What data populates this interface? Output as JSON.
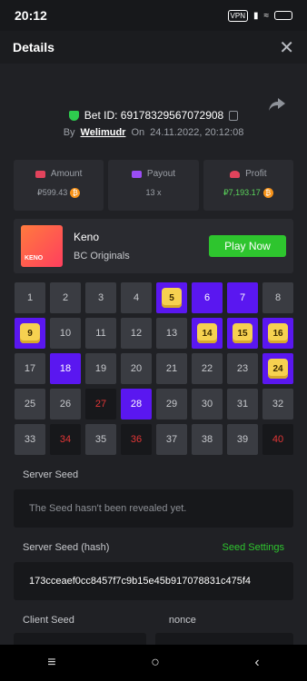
{
  "status": {
    "time": "20:12",
    "vpn": "VPN"
  },
  "header": {
    "title": "Details",
    "close": "✕"
  },
  "bet": {
    "id_label": "Bet ID: 69178329567072908",
    "by_label": "By",
    "username": "Welimudr",
    "on_label": "On",
    "date": "24.11.2022, 20:12:08"
  },
  "stats": {
    "amount": {
      "label": "Amount",
      "value": "₽599.43"
    },
    "payout": {
      "label": "Payout",
      "value": "13 x"
    },
    "profit": {
      "label": "Profit",
      "value": "₽7,193.17"
    }
  },
  "game": {
    "name": "Keno",
    "provider": "BC Originals",
    "thumb_label": "KENO",
    "play_label": "Play Now"
  },
  "keno": {
    "cells": [
      {
        "n": "1",
        "state": "normal"
      },
      {
        "n": "2",
        "state": "normal"
      },
      {
        "n": "3",
        "state": "normal"
      },
      {
        "n": "4",
        "state": "normal"
      },
      {
        "n": "5",
        "state": "hit"
      },
      {
        "n": "6",
        "state": "pick"
      },
      {
        "n": "7",
        "state": "pick"
      },
      {
        "n": "8",
        "state": "normal"
      },
      {
        "n": "9",
        "state": "hit"
      },
      {
        "n": "10",
        "state": "normal"
      },
      {
        "n": "11",
        "state": "normal"
      },
      {
        "n": "12",
        "state": "normal"
      },
      {
        "n": "13",
        "state": "normal"
      },
      {
        "n": "14",
        "state": "hit"
      },
      {
        "n": "15",
        "state": "hit"
      },
      {
        "n": "16",
        "state": "hit"
      },
      {
        "n": "17",
        "state": "normal"
      },
      {
        "n": "18",
        "state": "pick"
      },
      {
        "n": "19",
        "state": "normal"
      },
      {
        "n": "20",
        "state": "normal"
      },
      {
        "n": "21",
        "state": "normal"
      },
      {
        "n": "22",
        "state": "normal"
      },
      {
        "n": "23",
        "state": "normal"
      },
      {
        "n": "24",
        "state": "hit"
      },
      {
        "n": "25",
        "state": "normal"
      },
      {
        "n": "26",
        "state": "normal"
      },
      {
        "n": "27",
        "state": "miss"
      },
      {
        "n": "28",
        "state": "pick"
      },
      {
        "n": "29",
        "state": "normal"
      },
      {
        "n": "30",
        "state": "normal"
      },
      {
        "n": "31",
        "state": "normal"
      },
      {
        "n": "32",
        "state": "normal"
      },
      {
        "n": "33",
        "state": "normal"
      },
      {
        "n": "34",
        "state": "miss"
      },
      {
        "n": "35",
        "state": "normal"
      },
      {
        "n": "36",
        "state": "miss"
      },
      {
        "n": "37",
        "state": "normal"
      },
      {
        "n": "38",
        "state": "normal"
      },
      {
        "n": "39",
        "state": "normal"
      },
      {
        "n": "40",
        "state": "miss"
      }
    ]
  },
  "seeds": {
    "server_seed_label": "Server Seed",
    "server_seed_value": "The Seed hasn't been revealed yet.",
    "hash_label": "Server Seed (hash)",
    "settings_link": "Seed Settings",
    "hash_value": "173cceaef0cc8457f7c9b15e45b917078831c475f4",
    "client_seed_label": "Client Seed",
    "nonce_label": "nonce"
  },
  "colors": {
    "accent_green": "#2ec52e",
    "purple": "#5a17f0",
    "miss_red": "#e23636",
    "gem_yellow": "#f6d150"
  },
  "nav": {
    "menu": "≡",
    "home": "○",
    "back": "‹"
  }
}
